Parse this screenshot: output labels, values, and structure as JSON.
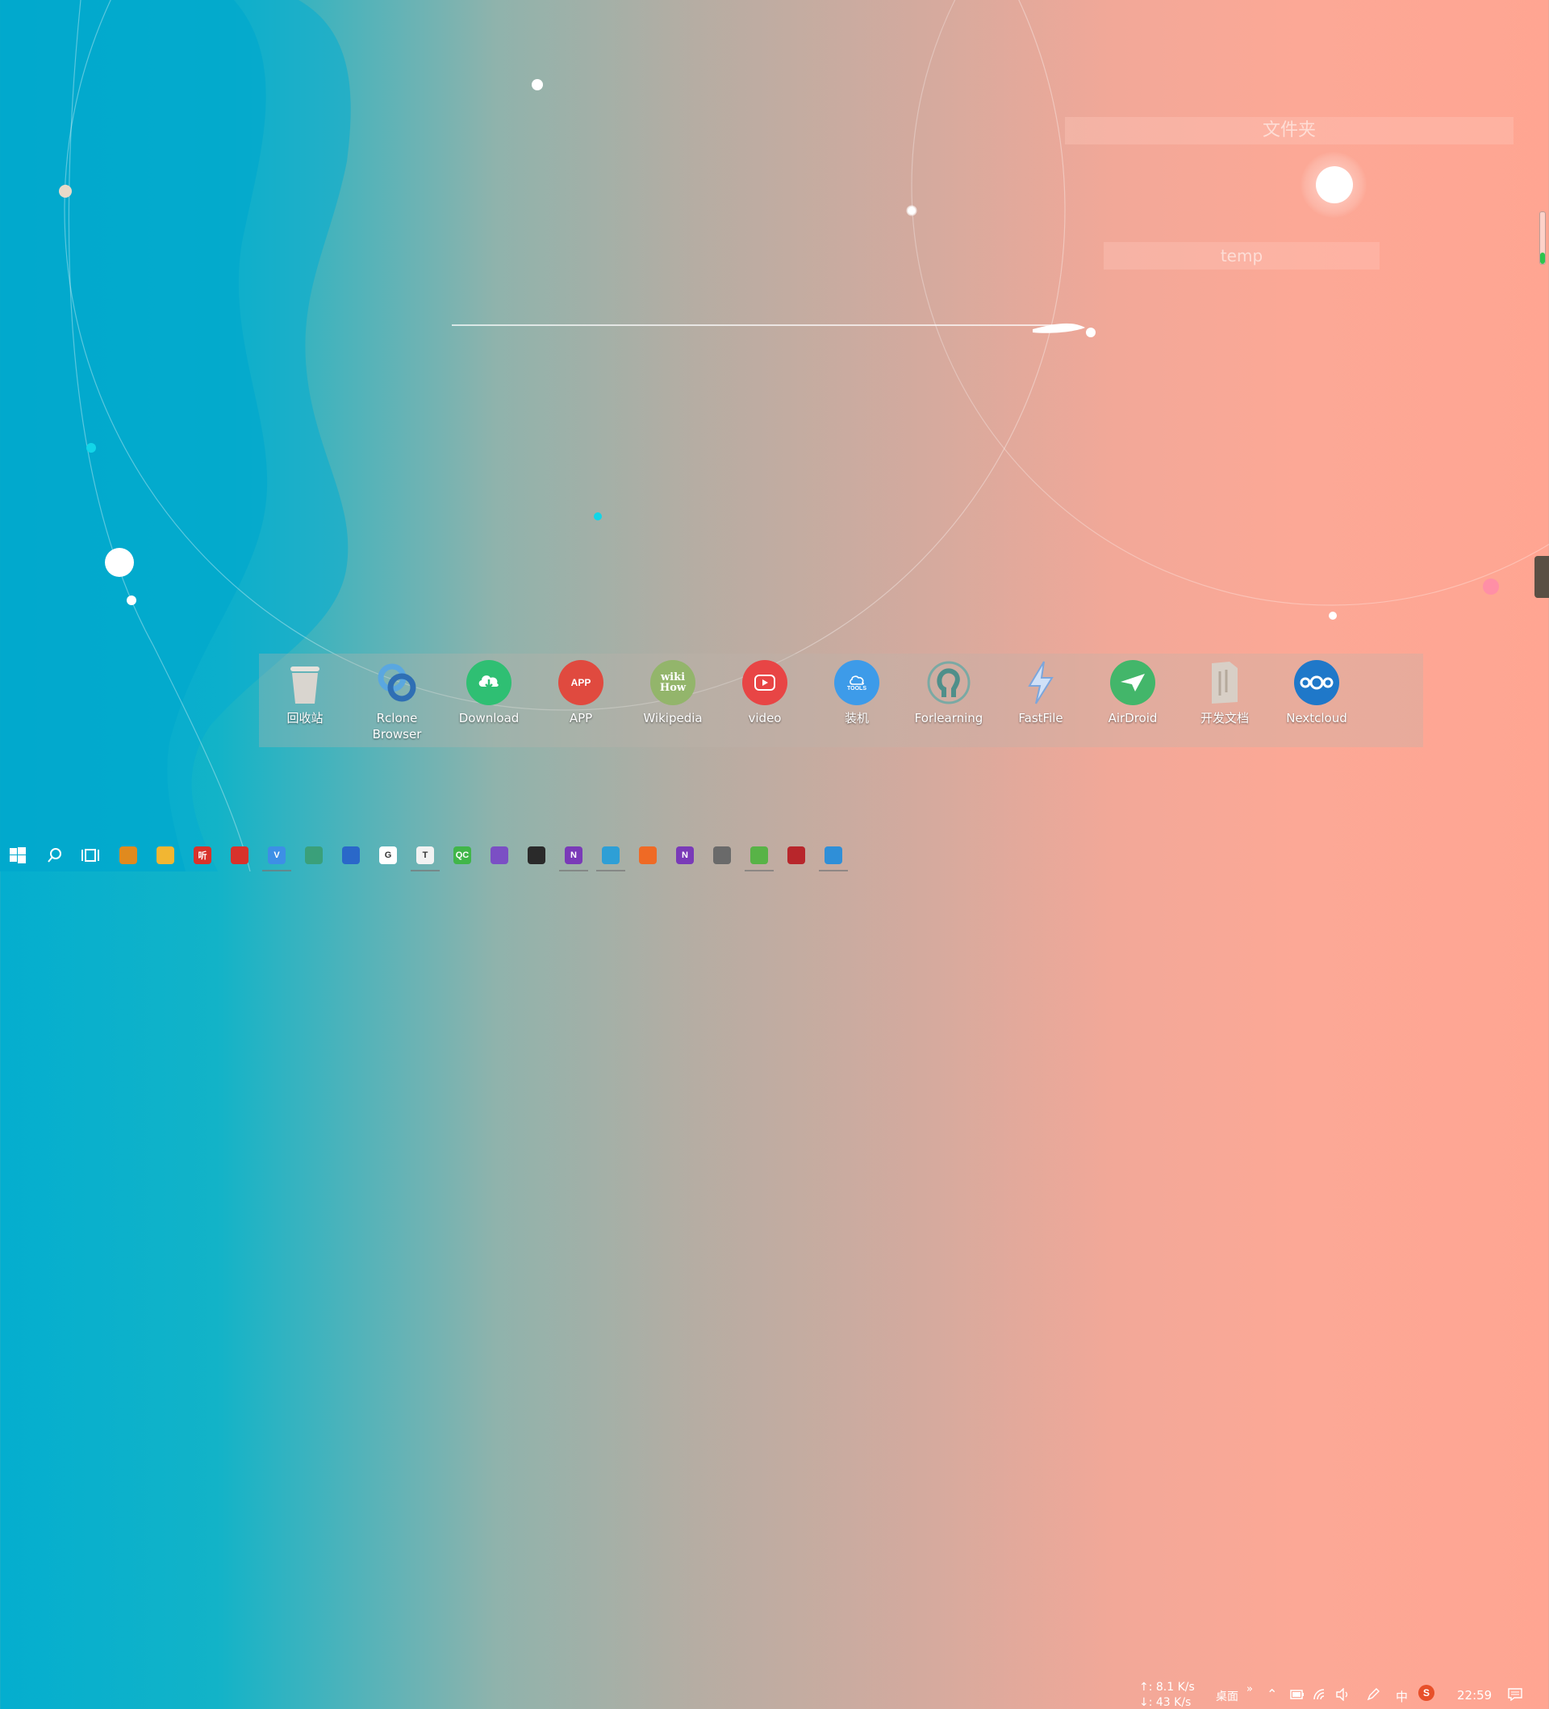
{
  "desktop": {
    "fences": {
      "folder_label": "文件夹",
      "temp_label": "temp"
    }
  },
  "dock": {
    "items": [
      {
        "label": "回收站",
        "icon": "recycle-bin-icon",
        "color": "#d9d5cf"
      },
      {
        "label": "Rclone Browser",
        "icon": "rclone-icon",
        "color": "#3f86c7"
      },
      {
        "label": "Download",
        "icon": "download-icon",
        "color": "#2fbf73"
      },
      {
        "label": "APP",
        "icon": "app-icon",
        "color": "#e04a3f"
      },
      {
        "label": "Wikipedia",
        "icon": "wikihow-icon",
        "color": "#93b56b"
      },
      {
        "label": "video",
        "icon": "video-icon",
        "color": "#e84545"
      },
      {
        "label": "装机",
        "icon": "cloud-tools-icon",
        "color": "#3d9be9"
      },
      {
        "label": "Forlearning",
        "icon": "open-source-icon",
        "color": "#5fa5a0"
      },
      {
        "label": "FastFile",
        "icon": "lightning-icon",
        "color": "#8fb8e8"
      },
      {
        "label": "AirDroid",
        "icon": "airdroid-icon",
        "color": "#43b66a"
      },
      {
        "label": "开发文档",
        "icon": "document-folder-icon",
        "color": "#d8cfc6"
      },
      {
        "label": "Nextcloud",
        "icon": "nextcloud-icon",
        "color": "#1f78c9"
      }
    ],
    "app_badge_text": "APP",
    "wikihow_text": "wiki How",
    "tools_text": "TOOLS"
  },
  "taskbar": {
    "apps": [
      {
        "icon": "everything-search-icon",
        "color": "#e08a1e",
        "text": ""
      },
      {
        "icon": "file-explorer-icon",
        "color": "#f2b632",
        "text": ""
      },
      {
        "icon": "listen-app-icon",
        "color": "#d8322b",
        "text": "听"
      },
      {
        "icon": "netease-music-icon",
        "color": "#d8322b",
        "text": ""
      },
      {
        "icon": "vivaldi-icon",
        "color": "#3d8fe6",
        "text": "V"
      },
      {
        "icon": "terminal-icon",
        "color": "#3aa07a",
        "text": ""
      },
      {
        "icon": "notepad-icon",
        "color": "#2a68c9",
        "text": ""
      },
      {
        "icon": "grammarly-icon",
        "color": "#ffffff",
        "text": "G"
      },
      {
        "icon": "typora-icon",
        "color": "#f2f2f2",
        "text": "T"
      },
      {
        "icon": "qt-creator-icon",
        "color": "#41b649",
        "text": "QC"
      },
      {
        "icon": "visual-studio-icon",
        "color": "#7b4fc4",
        "text": ""
      },
      {
        "icon": "nvidia-icon",
        "color": "#2a2a2a",
        "text": ""
      },
      {
        "icon": "onenote-icon",
        "color": "#7a3ab8",
        "text": "N"
      },
      {
        "icon": "edge-can-icon",
        "color": "#2e9fd6",
        "text": ""
      },
      {
        "icon": "firefox-icon",
        "color": "#ef6a25",
        "text": ""
      },
      {
        "icon": "onenote-2-icon",
        "color": "#7a3ab8",
        "text": "N"
      },
      {
        "icon": "device-icon",
        "color": "#6a6a6a",
        "text": ""
      },
      {
        "icon": "clover-icon",
        "color": "#58b347",
        "text": ""
      },
      {
        "icon": "pdf-editor-icon",
        "color": "#b8262b",
        "text": ""
      },
      {
        "icon": "edge-icon",
        "color": "#2f8fd8",
        "text": ""
      }
    ],
    "net_up": "↑: 8.1 K/s",
    "net_down": "↓: 43 K/s",
    "desk_label": "桌面",
    "ime_label": "中",
    "clock": "22:59"
  }
}
